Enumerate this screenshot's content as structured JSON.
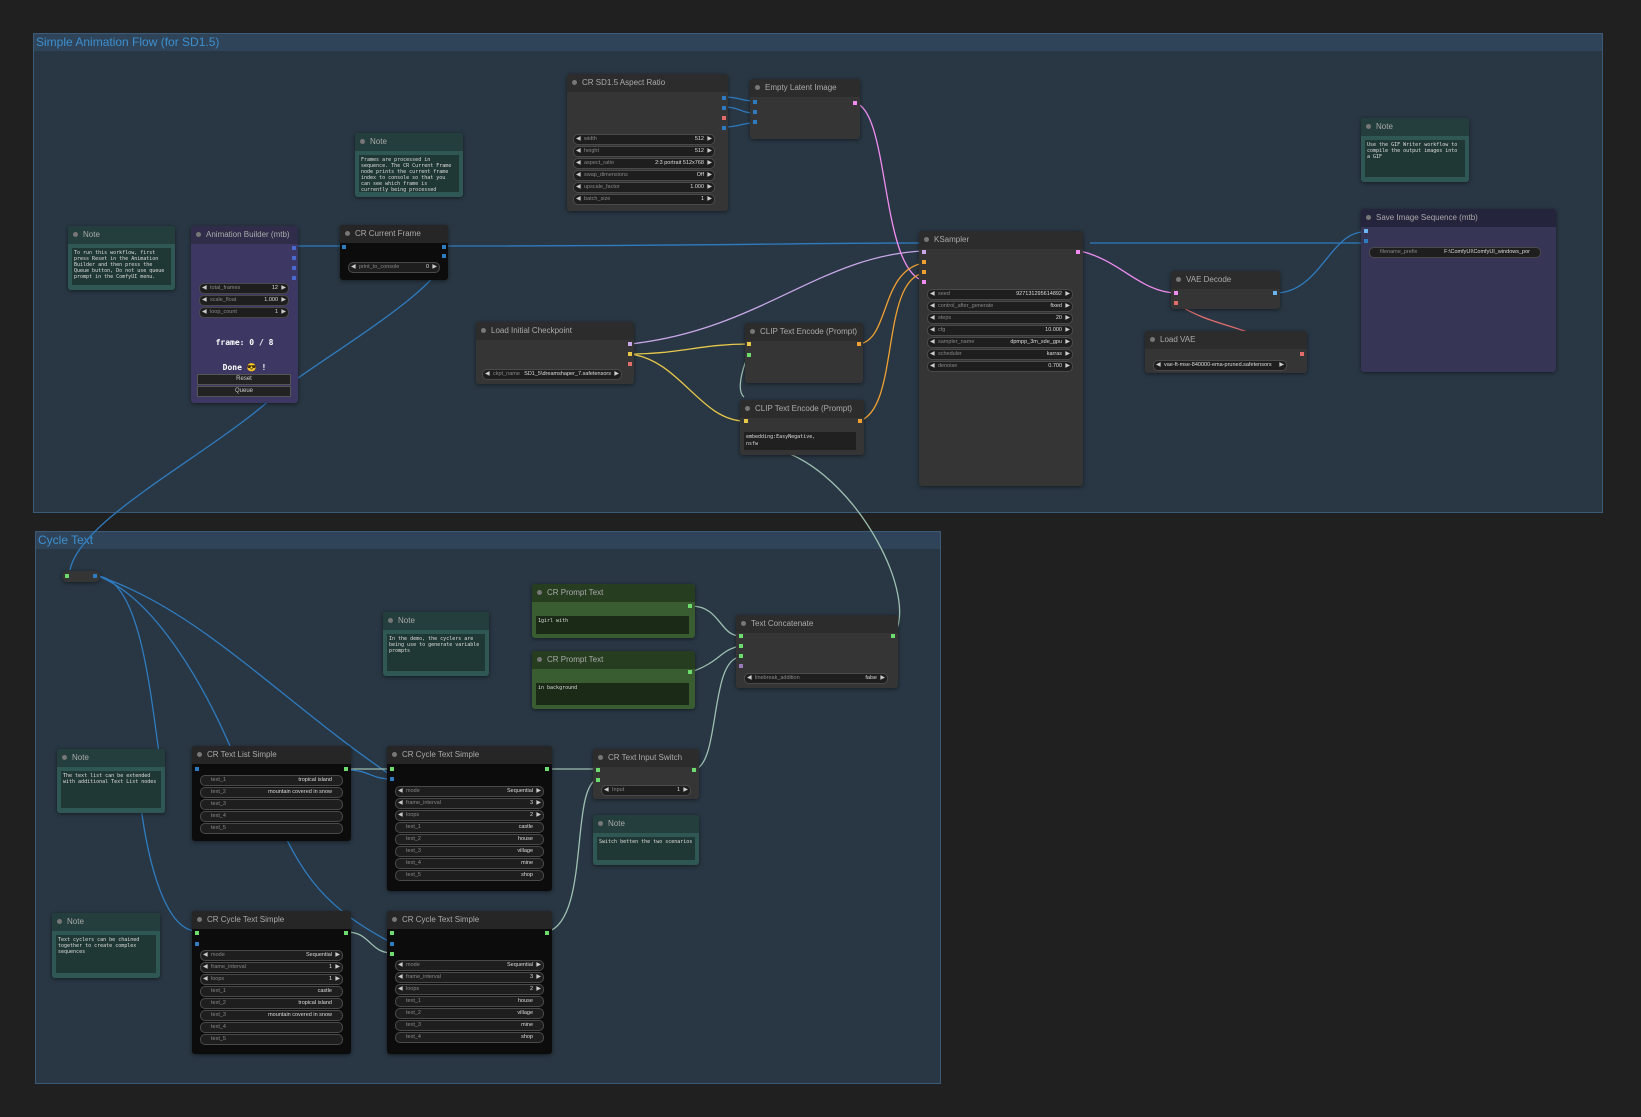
{
  "groups": {
    "animation": {
      "title": "Simple Animation Flow (for SD1.5)"
    },
    "cycle": {
      "title": "Cycle Text"
    }
  },
  "nodes": {
    "note1": {
      "title": "Note",
      "text": "To run this workflow, first press Reset in the Animation Builder and then press the Queue button, Do not use queue prompt in the ComfyUI menu."
    },
    "animation_builder": {
      "title": "Animation Builder (mtb)",
      "widgets": [
        {
          "name": "total_frames",
          "value": "12"
        },
        {
          "name": "scale_float",
          "value": "1.000"
        },
        {
          "name": "loop_count",
          "value": "1"
        }
      ],
      "frame_label": "frame: 0 / 8",
      "done_label": "Done 😎 !",
      "reset_label": "Reset",
      "queue_label": "Queue"
    },
    "current_frame": {
      "title": "CR Current Frame",
      "widget": {
        "name": "print_to_console",
        "value": "0"
      }
    },
    "note2": {
      "title": "Note",
      "text": "Frames are processed in sequence. The CR Current Frame node prints the current frame index to console so that you can see which frame is currently being processed"
    },
    "aspect_ratio": {
      "title": "CR SD1.5 Aspect Ratio",
      "widgets": [
        {
          "name": "width",
          "value": "512"
        },
        {
          "name": "height",
          "value": "512"
        },
        {
          "name": "aspect_ratio",
          "value": "2:3 portrait 512x768"
        },
        {
          "name": "swap_dimensions",
          "value": "Off"
        },
        {
          "name": "upscale_factor",
          "value": "1.000"
        },
        {
          "name": "batch_size",
          "value": "1"
        }
      ]
    },
    "empty_latent": {
      "title": "Empty Latent Image"
    },
    "load_checkpoint": {
      "title": "Load Initial Checkpoint",
      "widget": {
        "name": "ckpt_name",
        "value": "SD1_5\\dreamshaper_7.safetensors"
      }
    },
    "clip_pos": {
      "title": "CLIP Text Encode (Prompt)"
    },
    "clip_neg": {
      "title": "CLIP Text Encode (Prompt)",
      "text": "embedding:EasyNegative,\nnsfw"
    },
    "ksampler": {
      "title": "KSampler",
      "widgets": [
        {
          "name": "seed",
          "value": "927131295614892"
        },
        {
          "name": "control_after_generate",
          "value": "fixed"
        },
        {
          "name": "steps",
          "value": "20"
        },
        {
          "name": "cfg",
          "value": "10.000"
        },
        {
          "name": "sampler_name",
          "value": "dpmpp_3m_sde_gpu"
        },
        {
          "name": "scheduler",
          "value": "karras"
        },
        {
          "name": "denoise",
          "value": "0.700"
        }
      ]
    },
    "vae_decode": {
      "title": "VAE Decode"
    },
    "load_vae": {
      "title": "Load VAE",
      "widget": {
        "name": "vae_name",
        "value": "vae-ft-mse-840000-ema-pruned.safetensors"
      }
    },
    "note3": {
      "title": "Note",
      "text": "Use the GIF Writer workflow to compile the output images into a GIF"
    },
    "save_seq": {
      "title": "Save Image Sequence (mtb)",
      "widget": {
        "name": "filename_prefix",
        "value": "F:\\ComfyUI\\ComfyUI_windows_por"
      }
    },
    "prompt1": {
      "title": "CR Prompt Text",
      "text": "1girl with"
    },
    "prompt2": {
      "title": "CR Prompt Text",
      "text": "in background"
    },
    "note4": {
      "title": "Note",
      "text": "In the demo, the cyclers are being use to generate variable prompts"
    },
    "text_concat": {
      "title": "Text Concatenate",
      "widget": {
        "name": "linebreak_addition",
        "value": "false"
      }
    },
    "note5": {
      "title": "Note",
      "text": "The text list can be extended with additional Text List nodes"
    },
    "text_list": {
      "title": "CR Text List Simple",
      "widgets": [
        {
          "name": "text_1",
          "value": "tropical island"
        },
        {
          "name": "text_2",
          "value": "mountain covered in snow"
        },
        {
          "name": "text_3",
          "value": ""
        },
        {
          "name": "text_4",
          "value": ""
        },
        {
          "name": "text_5",
          "value": ""
        }
      ]
    },
    "cycle1": {
      "title": "CR Cycle Text Simple",
      "widgets": [
        {
          "name": "mode",
          "value": "Sequential"
        },
        {
          "name": "frame_interval",
          "value": "3"
        },
        {
          "name": "loops",
          "value": "2"
        },
        {
          "name": "text_1",
          "value": "castle"
        },
        {
          "name": "text_2",
          "value": "house"
        },
        {
          "name": "text_3",
          "value": "village"
        },
        {
          "name": "text_4",
          "value": "mine"
        },
        {
          "name": "text_5",
          "value": "shop"
        }
      ]
    },
    "input_switch": {
      "title": "CR Text Input Switch",
      "widget": {
        "name": "Input",
        "value": "1"
      }
    },
    "note6": {
      "title": "Note",
      "text": "Switch betten the two scenarios"
    },
    "note7": {
      "title": "Note",
      "text": "Text cyclers can be chained together to create complex sequences"
    },
    "cycle2": {
      "title": "CR Cycle Text Simple",
      "widgets": [
        {
          "name": "mode",
          "value": "Sequential"
        },
        {
          "name": "frame_interval",
          "value": "1"
        },
        {
          "name": "loops",
          "value": "1"
        },
        {
          "name": "text_1",
          "value": "castle"
        },
        {
          "name": "text_2",
          "value": "tropical island"
        },
        {
          "name": "text_3",
          "value": "mountain covered in snow"
        },
        {
          "name": "text_4",
          "value": ""
        },
        {
          "name": "text_5",
          "value": ""
        }
      ]
    },
    "cycle3": {
      "title": "CR Cycle Text Simple",
      "widgets": [
        {
          "name": "mode",
          "value": "Sequential"
        },
        {
          "name": "frame_interval",
          "value": "3"
        },
        {
          "name": "loops",
          "value": "2"
        },
        {
          "name": "text_1",
          "value": "house"
        },
        {
          "name": "text_2",
          "value": "village"
        },
        {
          "name": "text_3",
          "value": "mine"
        },
        {
          "name": "text_4",
          "value": "shop"
        }
      ]
    }
  },
  "colors": {
    "canvas": "#202020",
    "group": "#293744",
    "link_int": "#2f7bbf",
    "link_clip": "#e8c84a",
    "link_model": "#c8a8e8",
    "link_latent": "#f08cf0",
    "link_string": "#9dc0b0",
    "link_vae": "#e06c6c"
  }
}
